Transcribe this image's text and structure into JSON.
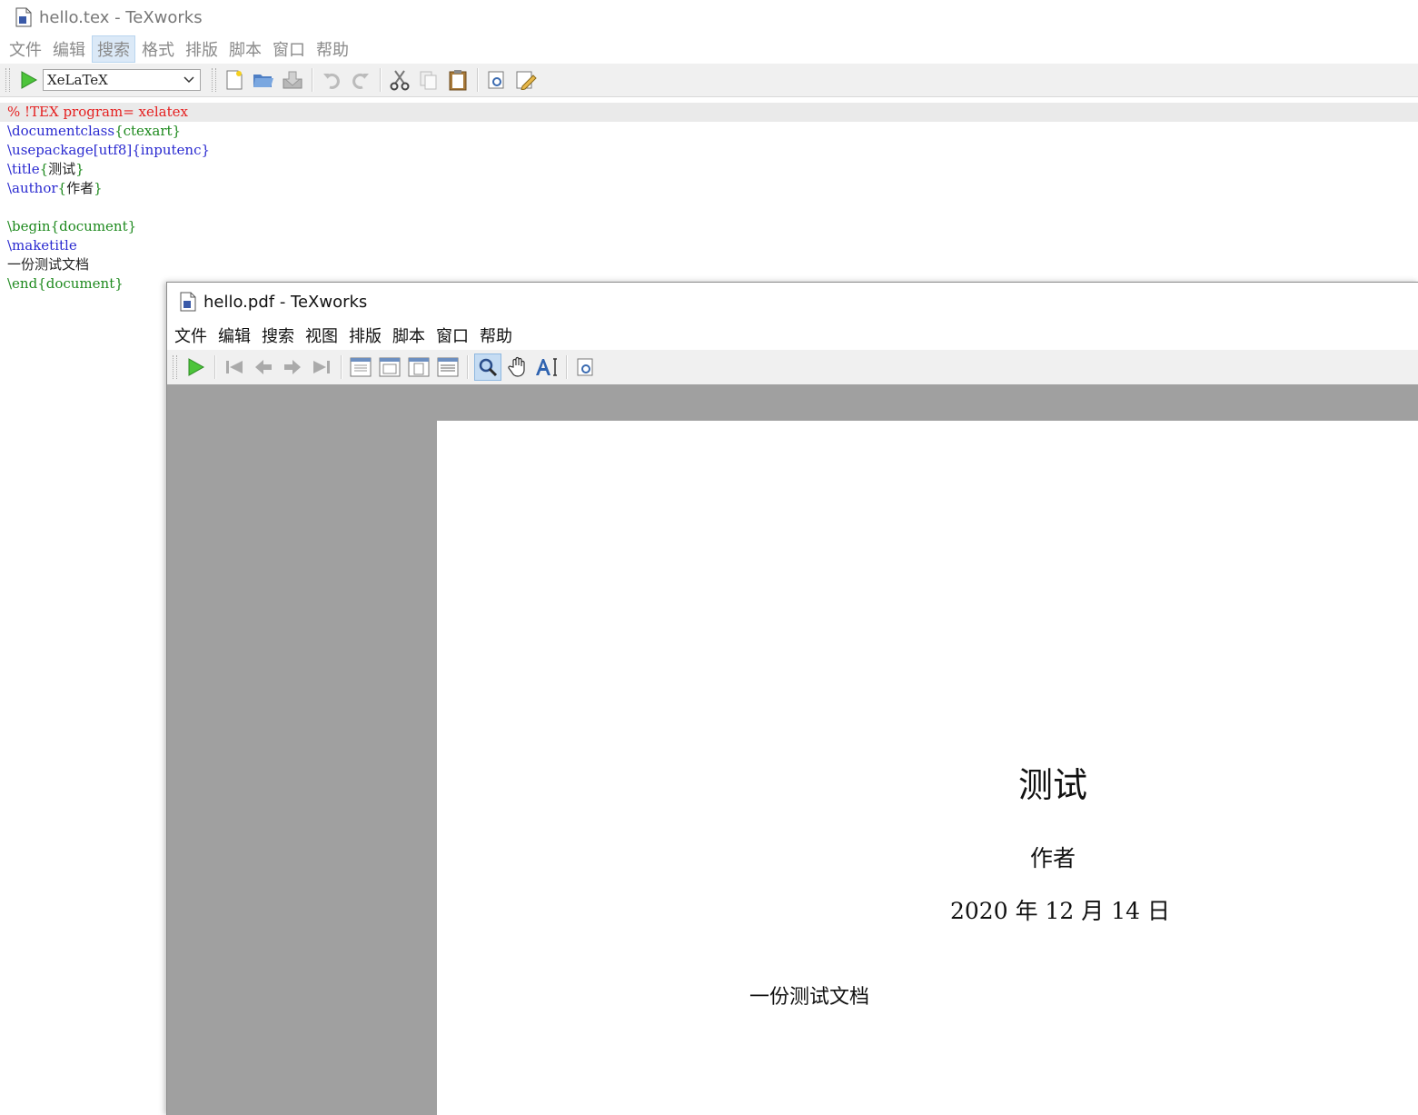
{
  "editor": {
    "title": "hello.tex - TeXworks",
    "menu": [
      "文件",
      "编辑",
      "搜索",
      "格式",
      "排版",
      "脚本",
      "窗口",
      "帮助"
    ],
    "active_menu_index": 2,
    "engine": "XeLaTeX",
    "code": {
      "line1": "% !TEX program= xelatex",
      "line2_cmd": "\\documentclass",
      "line2_arg": "{ctexart}",
      "line3_cmd": "\\usepackage",
      "line3_opt": "[utf8]",
      "line3_arg": "{inputenc}",
      "line4_cmd": "\\title",
      "line4_lb": "{",
      "line4_txt": "测试",
      "line4_rb": "}",
      "line5_cmd": "\\author",
      "line5_lb": "{",
      "line5_txt": "作者",
      "line5_rb": "}",
      "line7": "\\begin{document}",
      "line8": "\\maketitle",
      "line9": "一份测试文档",
      "line10": "\\end{document}"
    },
    "colors": {
      "comment": "#e52020",
      "command": "#2a2ad0",
      "group": "#1f8a1f"
    }
  },
  "pdf": {
    "title": "hello.pdf - TeXworks",
    "menu": [
      "文件",
      "编辑",
      "搜索",
      "视图",
      "排版",
      "脚本",
      "窗口",
      "帮助"
    ],
    "doc_title": "测试",
    "doc_author": "作者",
    "doc_date": "2020 年 12 月 14 日",
    "doc_body": "一份测试文档"
  }
}
